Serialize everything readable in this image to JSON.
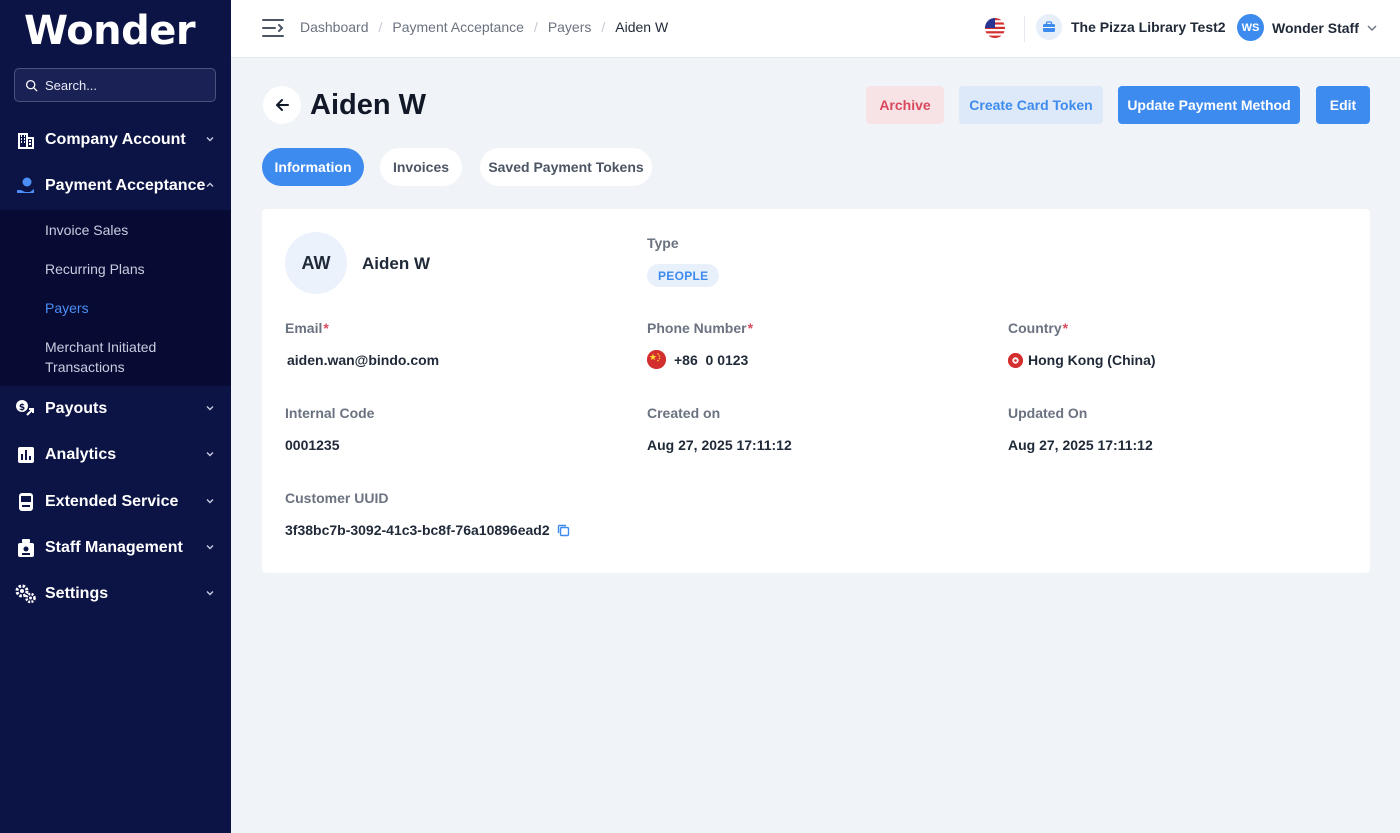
{
  "brand": {
    "logo_text": "Wonder"
  },
  "search": {
    "placeholder": "Search..."
  },
  "sidebar": {
    "items": [
      {
        "label": "Company Account",
        "icon": "building-icon",
        "expanded": false
      },
      {
        "label": "Payment Acceptance",
        "icon": "hand-coin-icon",
        "expanded": true
      },
      {
        "label": "Payouts",
        "icon": "payout-icon",
        "expanded": false
      },
      {
        "label": "Analytics",
        "icon": "bar-chart-icon",
        "expanded": false
      },
      {
        "label": "Extended Service",
        "icon": "terminal-icon",
        "expanded": false
      },
      {
        "label": "Staff Management",
        "icon": "staff-icon",
        "expanded": false
      },
      {
        "label": "Settings",
        "icon": "gears-icon",
        "expanded": false
      }
    ],
    "submenu": [
      {
        "label": "Invoice Sales",
        "active": false
      },
      {
        "label": "Recurring Plans",
        "active": false
      },
      {
        "label": "Payers",
        "active": true
      },
      {
        "label": "Merchant Initiated Transactions",
        "active": false
      }
    ]
  },
  "header": {
    "breadcrumbs": [
      "Dashboard",
      "Payment Acceptance",
      "Payers",
      "Aiden W"
    ],
    "breadcrumb_separator": "/",
    "store_name": "The Pizza Library Test2",
    "user_initials": "WS",
    "user_name": "Wonder Staff"
  },
  "page": {
    "title": "Aiden W",
    "buttons": {
      "archive": "Archive",
      "create_card_token": "Create Card Token",
      "update_payment_method": "Update Payment Method",
      "edit": "Edit"
    },
    "tabs": [
      {
        "label": "Information",
        "active": true
      },
      {
        "label": "Invoices",
        "active": false
      },
      {
        "label": "Saved Payment Tokens",
        "active": false
      }
    ]
  },
  "payer": {
    "initials": "AW",
    "name": "Aiden W",
    "type_label": "Type",
    "type_value": "PEOPLE",
    "email_label": "Email",
    "email_value": "aiden.wan@bindo.com",
    "phone_label": "Phone Number",
    "phone_value": "+86  0 0123",
    "country_label": "Country",
    "country_value": "Hong Kong (China)",
    "internal_code_label": "Internal Code",
    "internal_code_value": "0001235",
    "created_label": "Created on",
    "created_value": "Aug 27, 2025 17:11:12",
    "updated_label": "Updated On",
    "updated_value": "Aug 27, 2025 17:11:12",
    "uuid_label": "Customer UUID",
    "uuid_value": "3f38bc7b-3092-41c3-bc8f-76a10896ead2",
    "required_mark": "*"
  },
  "colors": {
    "sidebar_bg": "#0c1345",
    "submenu_bg": "#070b33",
    "accent": "#3d8bef",
    "danger": "#d9495d",
    "page_bg": "#f0f3f7"
  }
}
